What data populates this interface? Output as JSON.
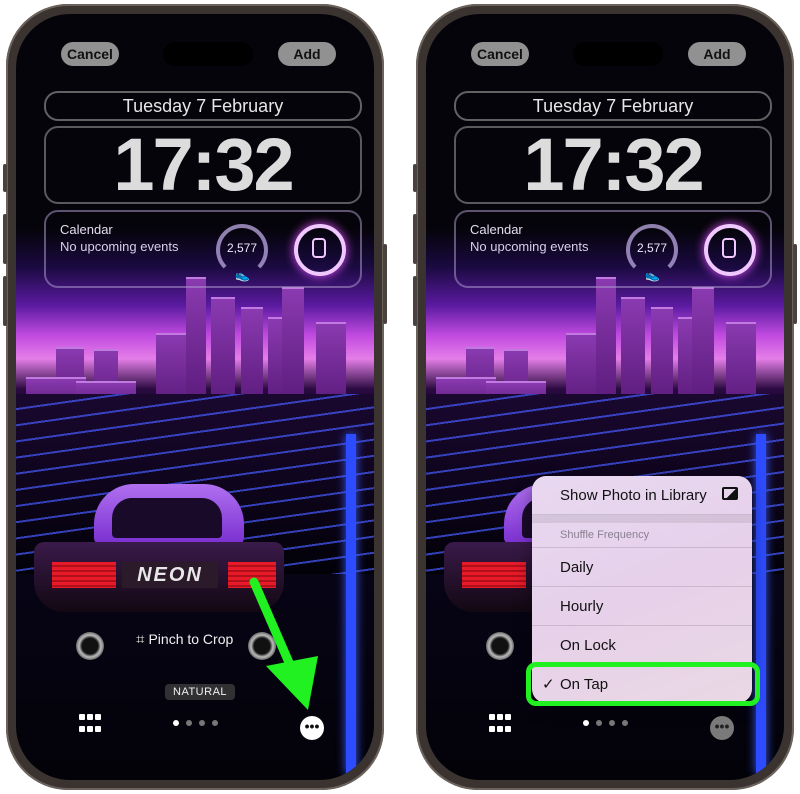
{
  "phones": [
    {
      "id": "left",
      "top_bar": {
        "cancel_label": "Cancel",
        "add_label": "Add"
      },
      "lock_screen": {
        "date": "Tuesday 7 February",
        "time": "17:32",
        "widgets": {
          "calendar_title": "Calendar",
          "calendar_subtitle": "No upcoming events",
          "steps_value": "2,577",
          "steps_icon": "shoe-icon",
          "watch_icon": "watch-battery-icon"
        }
      },
      "wallpaper": {
        "plate_text": "NEON"
      },
      "bottom": {
        "crop_hint": "Pinch to Crop",
        "crop_icon": "crop-icon",
        "filter_label": "NATURAL",
        "grid_icon": "grid-icon",
        "page_count": 4,
        "active_page": 1,
        "more_icon": "more-icon",
        "more_glyph": "•••"
      },
      "annotation": {
        "type": "arrow",
        "color": "#21f021",
        "points_to": "more-button"
      }
    },
    {
      "id": "right",
      "top_bar": {
        "cancel_label": "Cancel",
        "add_label": "Add"
      },
      "lock_screen": {
        "date": "Tuesday 7 February",
        "time": "17:32",
        "widgets": {
          "calendar_title": "Calendar",
          "calendar_subtitle": "No upcoming events",
          "steps_value": "2,577",
          "steps_icon": "shoe-icon",
          "watch_icon": "watch-battery-icon"
        }
      },
      "wallpaper": {
        "plate_text": "NEON"
      },
      "menu": {
        "show_photo_label": "Show Photo in Library",
        "show_photo_icon": "photo-library-icon",
        "section_header": "Shuffle Frequency",
        "options": [
          {
            "label": "Daily",
            "checked": false
          },
          {
            "label": "Hourly",
            "checked": false
          },
          {
            "label": "On Lock",
            "checked": false
          },
          {
            "label": "On Tap",
            "checked": true
          }
        ],
        "check_glyph": "✓"
      },
      "bottom": {
        "grid_icon": "grid-icon",
        "page_count": 4,
        "active_page": 1,
        "more_glyph": "•••"
      },
      "annotation": {
        "type": "highlight-box",
        "color": "#21f021",
        "target": "On Tap"
      }
    }
  ]
}
